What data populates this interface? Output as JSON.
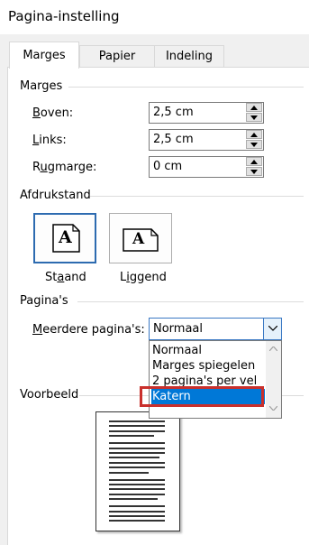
{
  "window": {
    "title": "Pagina-instelling"
  },
  "tabs": [
    {
      "label": "Marges",
      "active": true
    },
    {
      "label": "Papier",
      "active": false
    },
    {
      "label": "Indeling",
      "active": false
    }
  ],
  "margins": {
    "group_title": "Marges",
    "fields": [
      {
        "label": "Boven:",
        "mnemonic": "B",
        "rest": "oven:",
        "value": "2,5 cm"
      },
      {
        "label": "Links:",
        "mnemonic": "L",
        "rest": "inks:",
        "value": "2,5 cm"
      },
      {
        "label": "Rugmarge:",
        "pre": "R",
        "mnemonic": "u",
        "rest": "gmarge:",
        "value": "0 cm"
      }
    ]
  },
  "orientation": {
    "group_title": "Afdrukstand",
    "portrait": {
      "label": "Staand",
      "pre": "St",
      "mnemonic": "a",
      "rest": "and",
      "icon_letter": "A",
      "selected": true
    },
    "landscape": {
      "label": "Liggend",
      "pre": "L",
      "mnemonic": "i",
      "rest": "ggend",
      "icon_letter": "A",
      "selected": false
    }
  },
  "pages": {
    "group_title": "Pagina's",
    "multiple_label": "Meerdere pagina's:",
    "multiple_mnemonic": "M",
    "multiple_rest": "eerdere pagina's:",
    "selected": "Normaal",
    "options": [
      "Normaal",
      "Marges spiegelen",
      "2 pagina's per vel",
      "Katern"
    ],
    "highlighted_option": "Katern"
  },
  "preview": {
    "group_title": "Voorbeeld"
  },
  "colors": {
    "accent": "#0078d7",
    "highlight_border": "#c9302c",
    "selected_border": "#2d6bb0"
  }
}
